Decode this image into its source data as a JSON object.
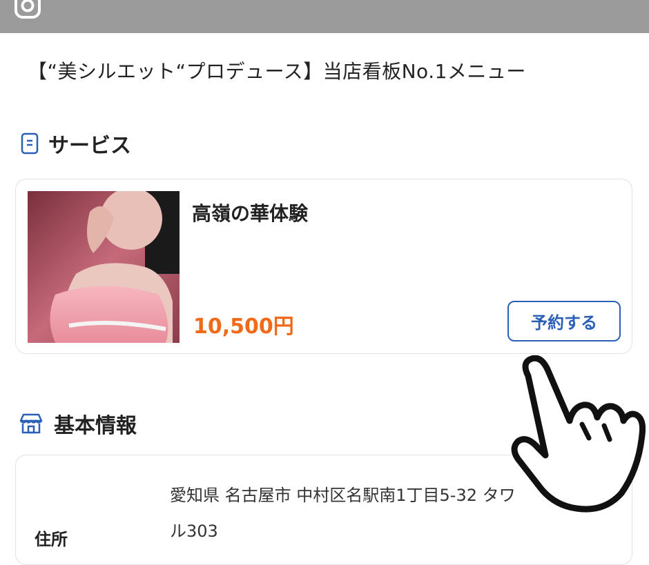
{
  "header": {
    "instagram_icon": "instagram-icon"
  },
  "headline": "【“美シルエット“プロデュース】当店看板No.1メニュー",
  "services": {
    "section_icon": "document-icon",
    "title": "サービス",
    "items": [
      {
        "name": "高嶺の華体験",
        "price": "10,500円",
        "button_label": "予約する"
      }
    ]
  },
  "basic_info": {
    "section_icon": "store-icon",
    "title": "基本情報",
    "address_label": "住所",
    "address_line1": "愛知県 名古屋市 中村区名駅南1丁目5-32 タワ",
    "address_line2": "ル303"
  },
  "overlay": {
    "pointer_icon": "tap-hand-icon"
  },
  "colors": {
    "accent_blue": "#2a5fb8",
    "price_orange": "#f06a17",
    "topbar_gray": "#9b9b9b"
  }
}
